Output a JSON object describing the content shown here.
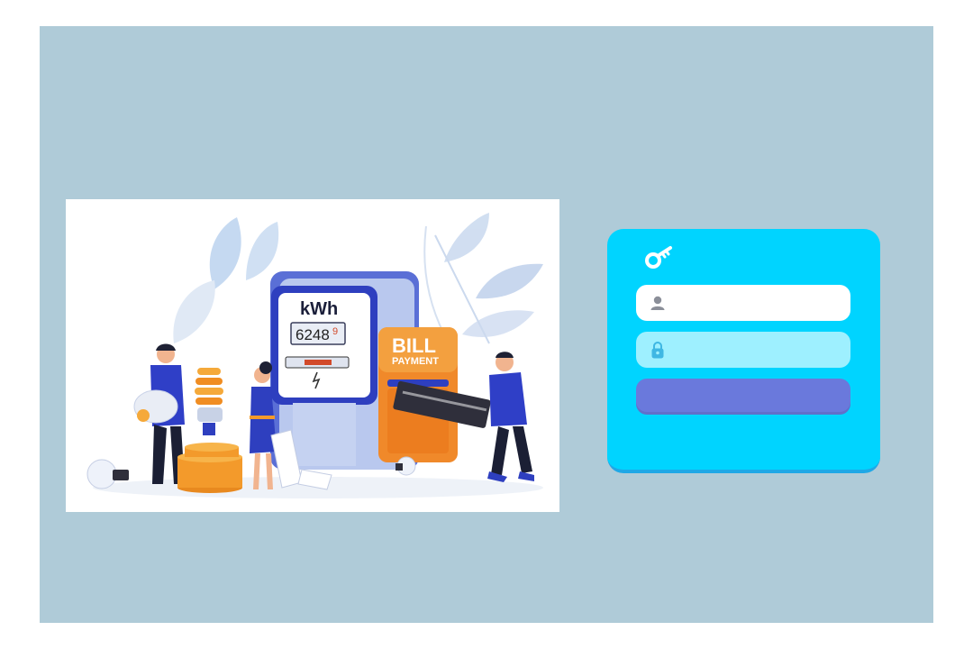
{
  "illustration": {
    "meter_unit": "kWh",
    "meter_reading": "6248",
    "meter_digit_small": "9",
    "bill_title": "BILL",
    "bill_subtitle": "PAYMENT"
  },
  "login": {
    "key_icon": "key-icon",
    "username_icon": "user-icon",
    "username_value": "",
    "password_icon": "lock-icon",
    "password_value": "",
    "submit_label": "",
    "colors": {
      "card": "#00d4ff",
      "username_field": "#ffffff",
      "password_field": "#9ef0ff",
      "button": "#6a79dc",
      "background": "#afcbd8"
    }
  }
}
